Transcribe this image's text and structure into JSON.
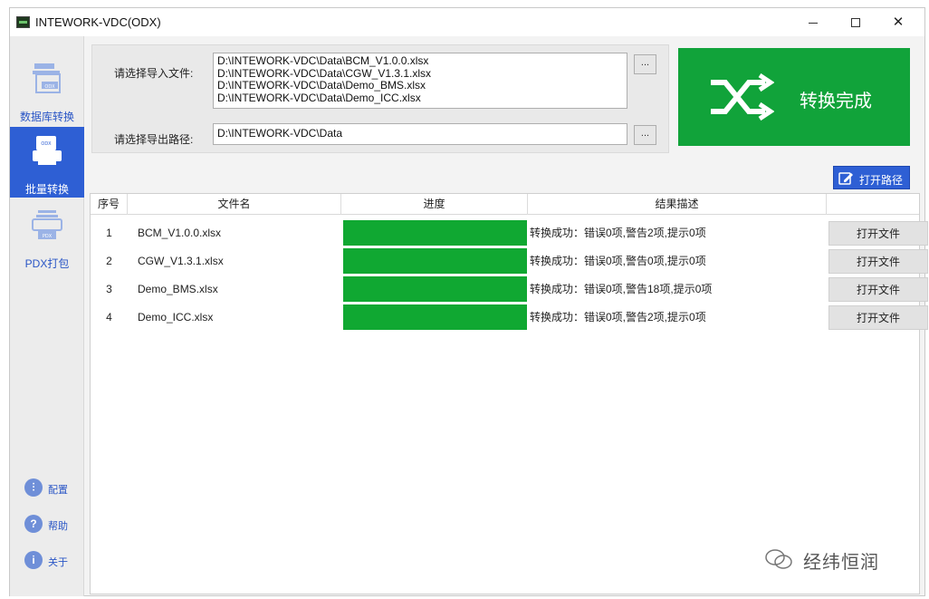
{
  "window": {
    "title": "INTEWORK-VDC(ODX)"
  },
  "sidebar": {
    "items": [
      {
        "label": "数据库转换",
        "icon": "odx-file-icon",
        "selected": false
      },
      {
        "label": "批量转换",
        "icon": "odx-batch-icon",
        "selected": true
      },
      {
        "label": "PDX打包",
        "icon": "pdx-package-icon",
        "selected": false
      }
    ],
    "utilities": [
      {
        "label": "配置",
        "icon": "config-icon"
      },
      {
        "label": "帮助",
        "icon": "help-icon"
      },
      {
        "label": "关于",
        "icon": "info-icon"
      }
    ]
  },
  "form": {
    "import_label": "请选择导入文件:",
    "import_files": [
      "D:\\INTEWORK-VDC\\Data\\BCM_V1.0.0.xlsx",
      "D:\\INTEWORK-VDC\\Data\\CGW_V1.3.1.xlsx",
      "D:\\INTEWORK-VDC\\Data\\Demo_BMS.xlsx",
      "D:\\INTEWORK-VDC\\Data\\Demo_ICC.xlsx"
    ],
    "export_label": "请选择导出路径:",
    "export_path": "D:\\INTEWORK-VDC\\Data",
    "browse_label": "..."
  },
  "status": {
    "text": "转换完成",
    "color": "#11a33a",
    "icon": "shuffle-icon"
  },
  "open_path_button": {
    "label": "打开路径",
    "icon": "edit-icon"
  },
  "table": {
    "headers": [
      "序号",
      "文件名",
      "进度",
      "结果描述",
      ""
    ],
    "rows": [
      {
        "index": "1",
        "file": "BCM_V1.0.0.xlsx",
        "progress": 1.0,
        "result": "转换成功：错误0项,警告2项,提示0项",
        "action": "打开文件"
      },
      {
        "index": "2",
        "file": "CGW_V1.3.1.xlsx",
        "progress": 1.0,
        "result": "转换成功：错误0项,警告0项,提示0项",
        "action": "打开文件"
      },
      {
        "index": "3",
        "file": "Demo_BMS.xlsx",
        "progress": 1.0,
        "result": "转换成功：错误0项,警告18项,提示0项",
        "action": "打开文件"
      },
      {
        "index": "4",
        "file": "Demo_ICC.xlsx",
        "progress": 1.0,
        "result": "转换成功：错误0项,警告2项,提示0项",
        "action": "打开文件"
      }
    ]
  },
  "watermark": {
    "text": "经纬恒润",
    "icon": "wechat-icon"
  }
}
